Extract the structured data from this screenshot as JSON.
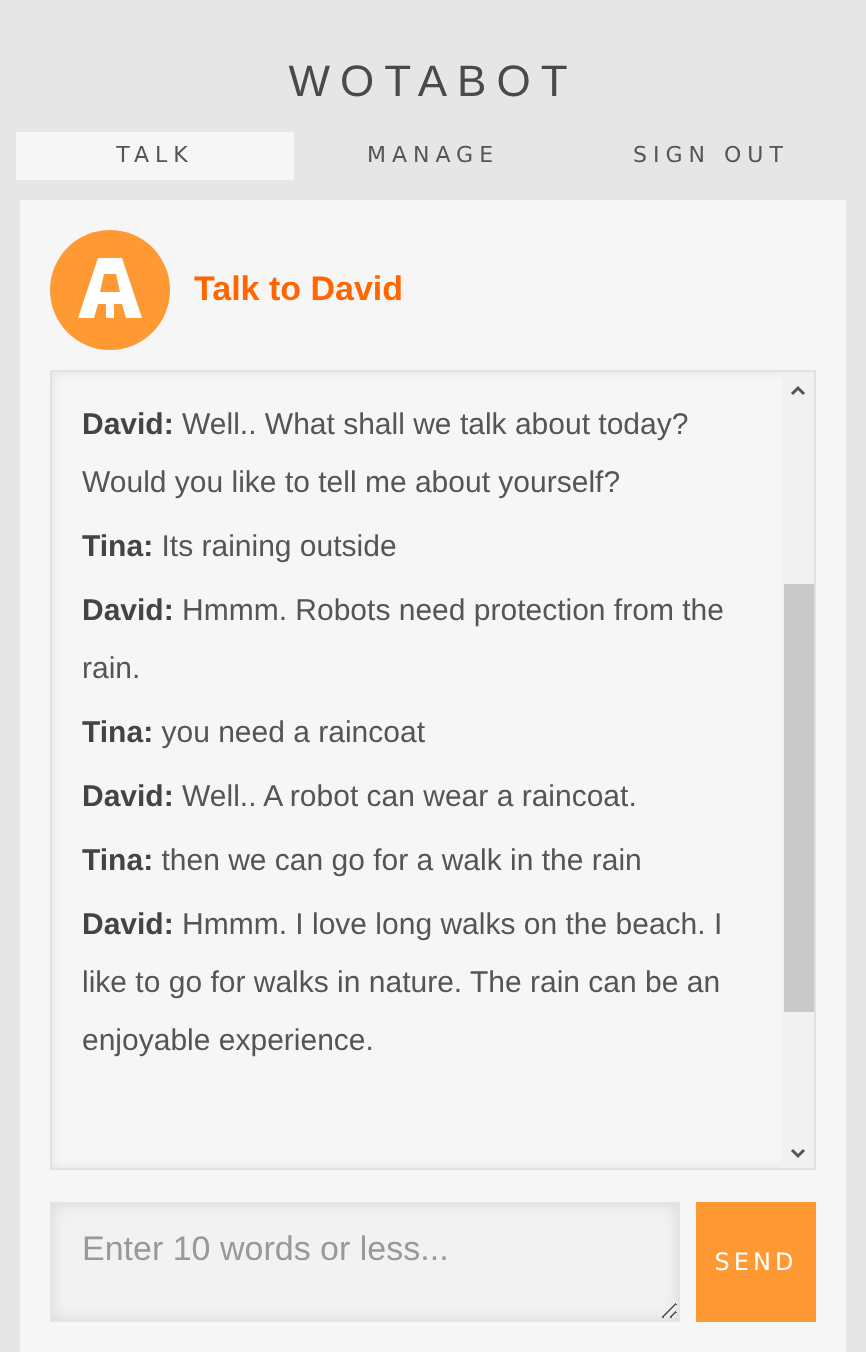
{
  "logo": "WOTABOT",
  "tabs": [
    {
      "label": "TALK",
      "selected": true
    },
    {
      "label": "MANAGE",
      "selected": false
    },
    {
      "label": "SIGN OUT",
      "selected": false
    }
  ],
  "title": "Talk to David",
  "messages": [
    {
      "text": "**David:** Well.. What shall we talk about today? Would you like to tell me about yourself?"
    },
    {
      "text": "**Tina:** Its raining outside"
    },
    {
      "text": "**David:** Hmmm. Robots need protection from the rain."
    },
    {
      "text": "**Tina:** you need a raincoat"
    },
    {
      "text": "**David:** Well.. A robot can wear a raincoat."
    },
    {
      "text": "**Tina:** then we can go for a walk in the rain"
    },
    {
      "text": "**David:** Hmmm. I love long walks on the beach. I like to go for walks in nature. The rain can be an enjoyable experience."
    }
  ],
  "input": {
    "placeholder": "Enter 10 words or less..."
  },
  "send_button": "SEND"
}
